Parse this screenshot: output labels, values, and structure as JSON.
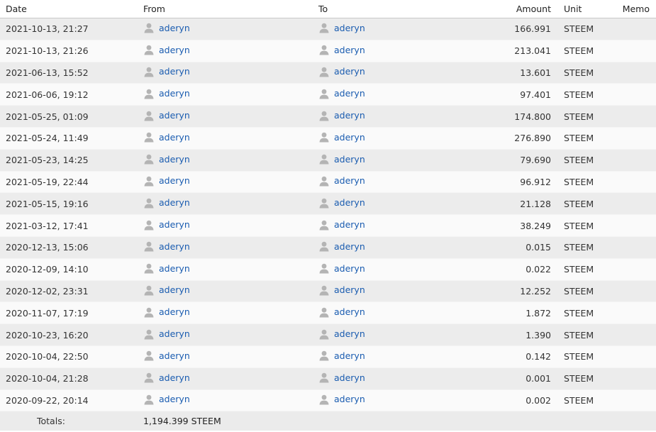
{
  "header": {
    "date": "Date",
    "from": "From",
    "to": "To",
    "amount": "Amount",
    "unit": "Unit",
    "memo": "Memo"
  },
  "rows": [
    {
      "date": "2021-10-13, 21:27",
      "from": "aderyn",
      "to": "aderyn",
      "amount": "166.991",
      "unit": "STEEM",
      "memo": ""
    },
    {
      "date": "2021-10-13, 21:26",
      "from": "aderyn",
      "to": "aderyn",
      "amount": "213.041",
      "unit": "STEEM",
      "memo": ""
    },
    {
      "date": "2021-06-13, 15:52",
      "from": "aderyn",
      "to": "aderyn",
      "amount": "13.601",
      "unit": "STEEM",
      "memo": ""
    },
    {
      "date": "2021-06-06, 19:12",
      "from": "aderyn",
      "to": "aderyn",
      "amount": "97.401",
      "unit": "STEEM",
      "memo": ""
    },
    {
      "date": "2021-05-25, 01:09",
      "from": "aderyn",
      "to": "aderyn",
      "amount": "174.800",
      "unit": "STEEM",
      "memo": ""
    },
    {
      "date": "2021-05-24, 11:49",
      "from": "aderyn",
      "to": "aderyn",
      "amount": "276.890",
      "unit": "STEEM",
      "memo": ""
    },
    {
      "date": "2021-05-23, 14:25",
      "from": "aderyn",
      "to": "aderyn",
      "amount": "79.690",
      "unit": "STEEM",
      "memo": ""
    },
    {
      "date": "2021-05-19, 22:44",
      "from": "aderyn",
      "to": "aderyn",
      "amount": "96.912",
      "unit": "STEEM",
      "memo": ""
    },
    {
      "date": "2021-05-15, 19:16",
      "from": "aderyn",
      "to": "aderyn",
      "amount": "21.128",
      "unit": "STEEM",
      "memo": ""
    },
    {
      "date": "2021-03-12, 17:41",
      "from": "aderyn",
      "to": "aderyn",
      "amount": "38.249",
      "unit": "STEEM",
      "memo": ""
    },
    {
      "date": "2020-12-13, 15:06",
      "from": "aderyn",
      "to": "aderyn",
      "amount": "0.015",
      "unit": "STEEM",
      "memo": ""
    },
    {
      "date": "2020-12-09, 14:10",
      "from": "aderyn",
      "to": "aderyn",
      "amount": "0.022",
      "unit": "STEEM",
      "memo": ""
    },
    {
      "date": "2020-12-02, 23:31",
      "from": "aderyn",
      "to": "aderyn",
      "amount": "12.252",
      "unit": "STEEM",
      "memo": ""
    },
    {
      "date": "2020-11-07, 17:19",
      "from": "aderyn",
      "to": "aderyn",
      "amount": "1.872",
      "unit": "STEEM",
      "memo": ""
    },
    {
      "date": "2020-10-23, 16:20",
      "from": "aderyn",
      "to": "aderyn",
      "amount": "1.390",
      "unit": "STEEM",
      "memo": ""
    },
    {
      "date": "2020-10-04, 22:50",
      "from": "aderyn",
      "to": "aderyn",
      "amount": "0.142",
      "unit": "STEEM",
      "memo": ""
    },
    {
      "date": "2020-10-04, 21:28",
      "from": "aderyn",
      "to": "aderyn",
      "amount": "0.001",
      "unit": "STEEM",
      "memo": ""
    },
    {
      "date": "2020-09-22, 20:14",
      "from": "aderyn",
      "to": "aderyn",
      "amount": "0.002",
      "unit": "STEEM",
      "memo": ""
    }
  ],
  "totals": {
    "label": "Totals:",
    "value": "1,194.399 STEEM"
  },
  "icons": {
    "user": "user-avatar-icon"
  },
  "colors": {
    "link": "#1a5cb0",
    "row_odd": "#ececec",
    "row_even": "#fafafa",
    "avatar": "#b4b4b4"
  }
}
